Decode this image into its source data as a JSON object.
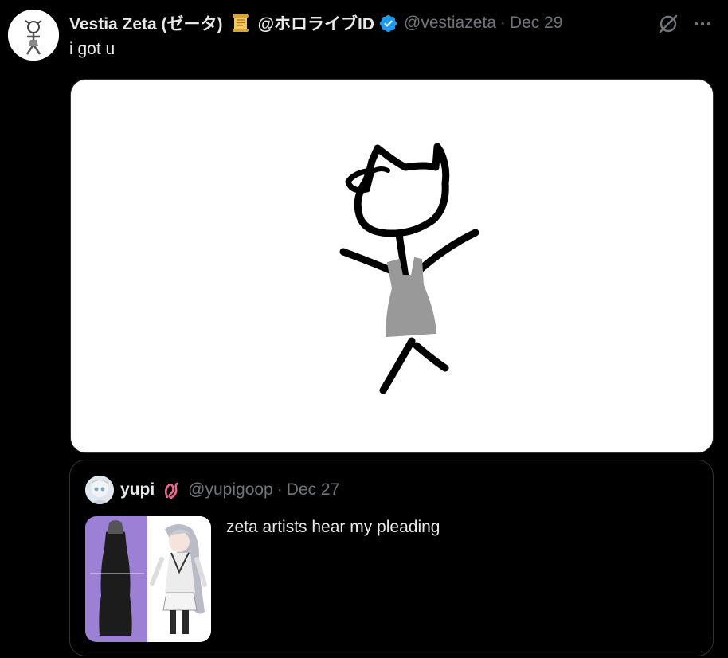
{
  "tweet": {
    "display_name": "Vestia Zeta (ゼータ)",
    "name_suffix": "@ホロライブID",
    "username": "@vestiazeta",
    "separator": "·",
    "timestamp": "Dec 29",
    "text": "i got u",
    "icons": {
      "avatar": "avatar",
      "badge": "scroll-emoji-icon",
      "verified": "verified-badge-icon",
      "grok": "grok-icon",
      "more": "more-options-icon"
    }
  },
  "quote": {
    "display_name": "yupi",
    "username": "@yupigoop",
    "separator": "·",
    "timestamp": "Dec 27",
    "text": "zeta artists hear my pleading",
    "icons": {
      "emoji": "pink-ribbon-emoji-icon"
    }
  },
  "colors": {
    "background": "#000000",
    "text_primary": "#e7e9ea",
    "text_secondary": "#71767b",
    "border": "#2f3336",
    "verified": "#1d9bf0"
  }
}
